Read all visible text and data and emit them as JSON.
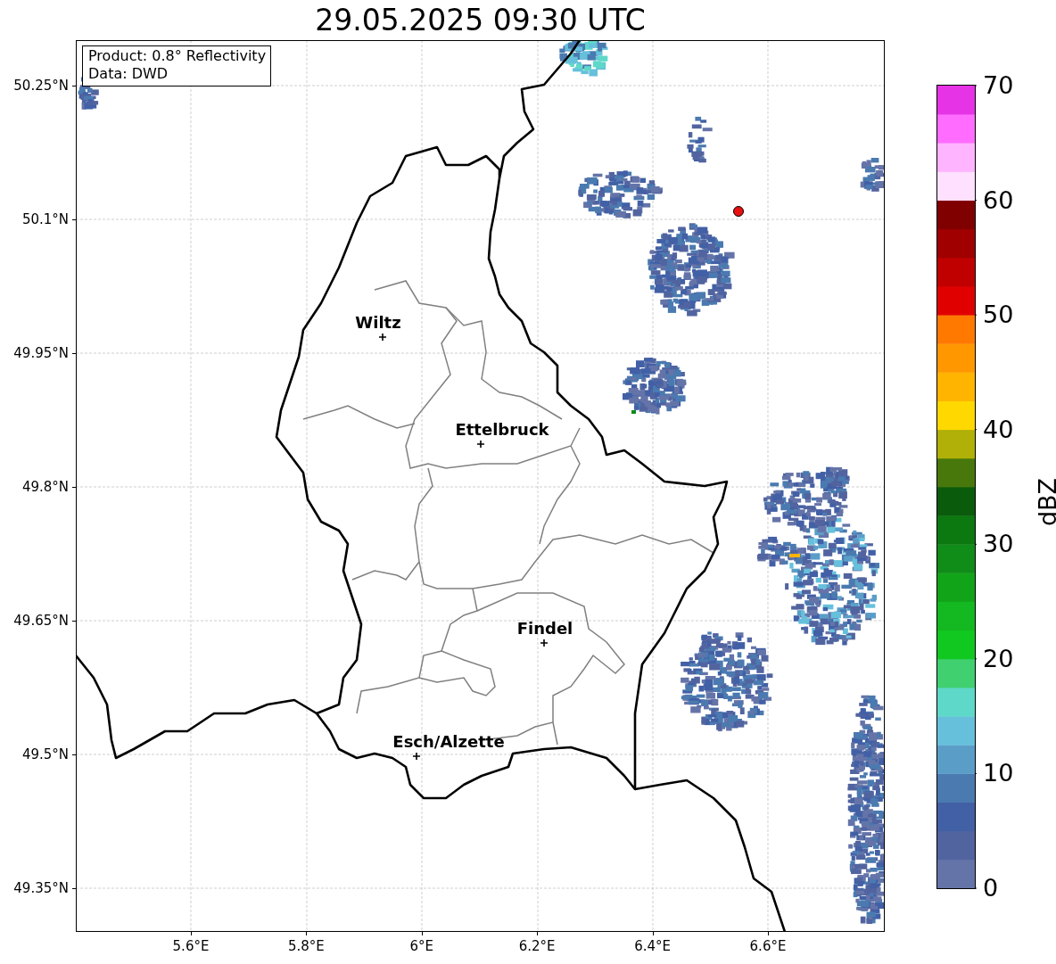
{
  "title": "29.05.2025 09:30 UTC",
  "info_box": [
    "Product: 0.8° Reflectivity",
    "Data: DWD"
  ],
  "x_ticks": [
    "5.6°E",
    "5.8°E",
    "6°E",
    "6.2°E",
    "6.4°E",
    "6.6°E"
  ],
  "y_ticks": [
    "50.25°N",
    "50.1°N",
    "49.95°N",
    "49.8°N",
    "49.65°N",
    "49.5°N",
    "49.35°N"
  ],
  "cities": [
    {
      "name": "Wiltz"
    },
    {
      "name": "Ettelbruck"
    },
    {
      "name": "Findel"
    },
    {
      "name": "Esch/Alzette"
    }
  ],
  "colorbar": {
    "label": "dBZ",
    "ticks": [
      "70",
      "60",
      "50",
      "40",
      "30",
      "20",
      "10",
      "0"
    ]
  }
}
